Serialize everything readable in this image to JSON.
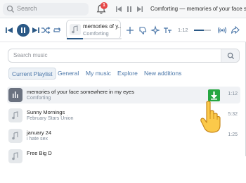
{
  "topbar": {
    "search_label": "Search",
    "notifications_count": "1",
    "current_track": "Comforting — memories of your face somewhere in my eyes"
  },
  "player": {
    "title": "memories of y...",
    "artist": "Comforting",
    "time": "1:12",
    "progress": 0.3,
    "volume": 0.6
  },
  "search": {
    "placeholder": "Search music"
  },
  "tabs": [
    {
      "label": "Current Playlist",
      "active": true
    },
    {
      "label": "General",
      "active": false
    },
    {
      "label": "My music",
      "active": false
    },
    {
      "label": "Explore",
      "active": false
    },
    {
      "label": "New additions",
      "active": false
    }
  ],
  "tracks": [
    {
      "title": "memories of your face somewhere in my eyes",
      "artist": "Comforting",
      "duration": "1:12",
      "highlighted": true
    },
    {
      "title": "Sunny Mornings",
      "artist": "February Stars Union",
      "duration": "5:32",
      "highlighted": false
    },
    {
      "title": "january 24",
      "artist": "i hate sex",
      "duration": "1:25",
      "highlighted": false
    },
    {
      "title": "Free Big D",
      "artist": "",
      "duration": "",
      "highlighted": false
    }
  ],
  "colors": {
    "accent": "#2a5885",
    "link": "#4a76a8",
    "badge": "#e64646",
    "download": "#26a641"
  }
}
